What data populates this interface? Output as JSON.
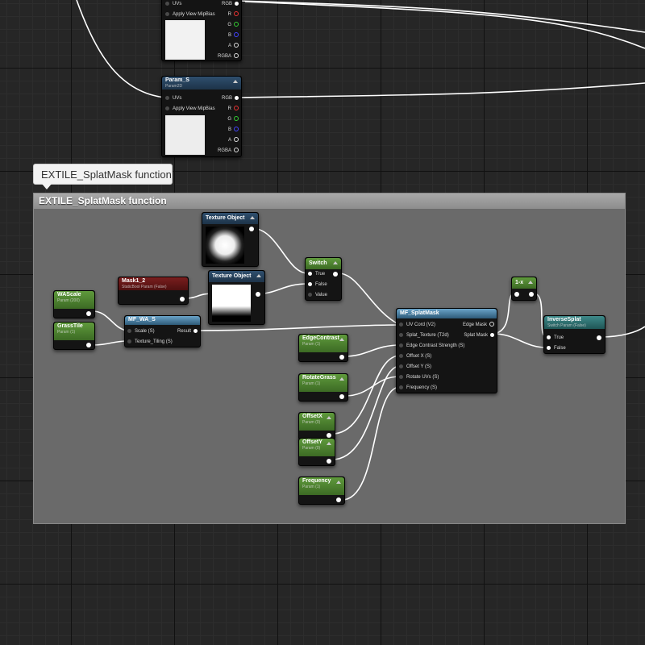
{
  "comment": {
    "bubble_text": "EXTILE_SplatMask function",
    "title": "EXTILE_SplatMask function"
  },
  "texture_sample_top": {
    "inputs": [
      "UVs",
      "Apply View MipBias"
    ],
    "outputs": [
      "RGB",
      "R",
      "G",
      "B",
      "A",
      "RGBA"
    ]
  },
  "param_s": {
    "title": "Param_S",
    "subtitle": "Param2D",
    "inputs": [
      "UVs",
      "Apply View MipBias"
    ],
    "outputs": [
      "RGB",
      "R",
      "G",
      "B",
      "A",
      "RGBA"
    ]
  },
  "texture_object_1": {
    "title": "Texture Object"
  },
  "texture_object_2": {
    "title": "Texture Object"
  },
  "mask_1_2": {
    "title": "Mask1_2",
    "subtitle": "StaticBool Param (False)"
  },
  "switch": {
    "title": "Switch",
    "inputs": [
      "True",
      "False",
      "Value"
    ]
  },
  "wa_scale": {
    "title": "WAScale",
    "subtitle": "Param (200)"
  },
  "grass_tile": {
    "title": "GrassTile",
    "subtitle": "Param (1)"
  },
  "mf_wa_s": {
    "title": "MF_WA_S",
    "inputs": [
      "Scale (S)",
      "Texture_Tiling (S)"
    ],
    "output": "Result"
  },
  "edge_contrast": {
    "title": "EdgeContrast",
    "subtitle": "Param (1)"
  },
  "rotate_grass": {
    "title": "RotateGrass",
    "subtitle": "Param (1)"
  },
  "offset_x": {
    "title": "OffsetX",
    "subtitle": "Param (0)"
  },
  "offset_y": {
    "title": "OffsetY",
    "subtitle": "Param (0)"
  },
  "frequency": {
    "title": "Frequency",
    "subtitle": "Param (1)"
  },
  "mf_splat_mask": {
    "title": "MF_SplatMask",
    "inputs": [
      "UV Cord (V2)",
      "Splat_Texture (T2d)",
      "Edge Contrast Strength (S)",
      "Offset X (S)",
      "Offset Y (S)",
      "Rotate UVs (S)",
      "Frequency (S)"
    ],
    "outputs": [
      "Edge Mask",
      "Splat Mask"
    ]
  },
  "one_minus_x": {
    "title": "1-x"
  },
  "inverse_splat": {
    "title": "InverseSplat",
    "subtitle": "Switch Param (False)",
    "inputs": [
      "True",
      "False"
    ]
  },
  "colors": {
    "param_header": "#2f4f6e",
    "green_header": "#5f9a3c",
    "function_header": "#6aa3c8",
    "static_bool_header": "#7a1e1e",
    "switch_param_header": "#3e8a8a",
    "wire": "#ffffff"
  }
}
